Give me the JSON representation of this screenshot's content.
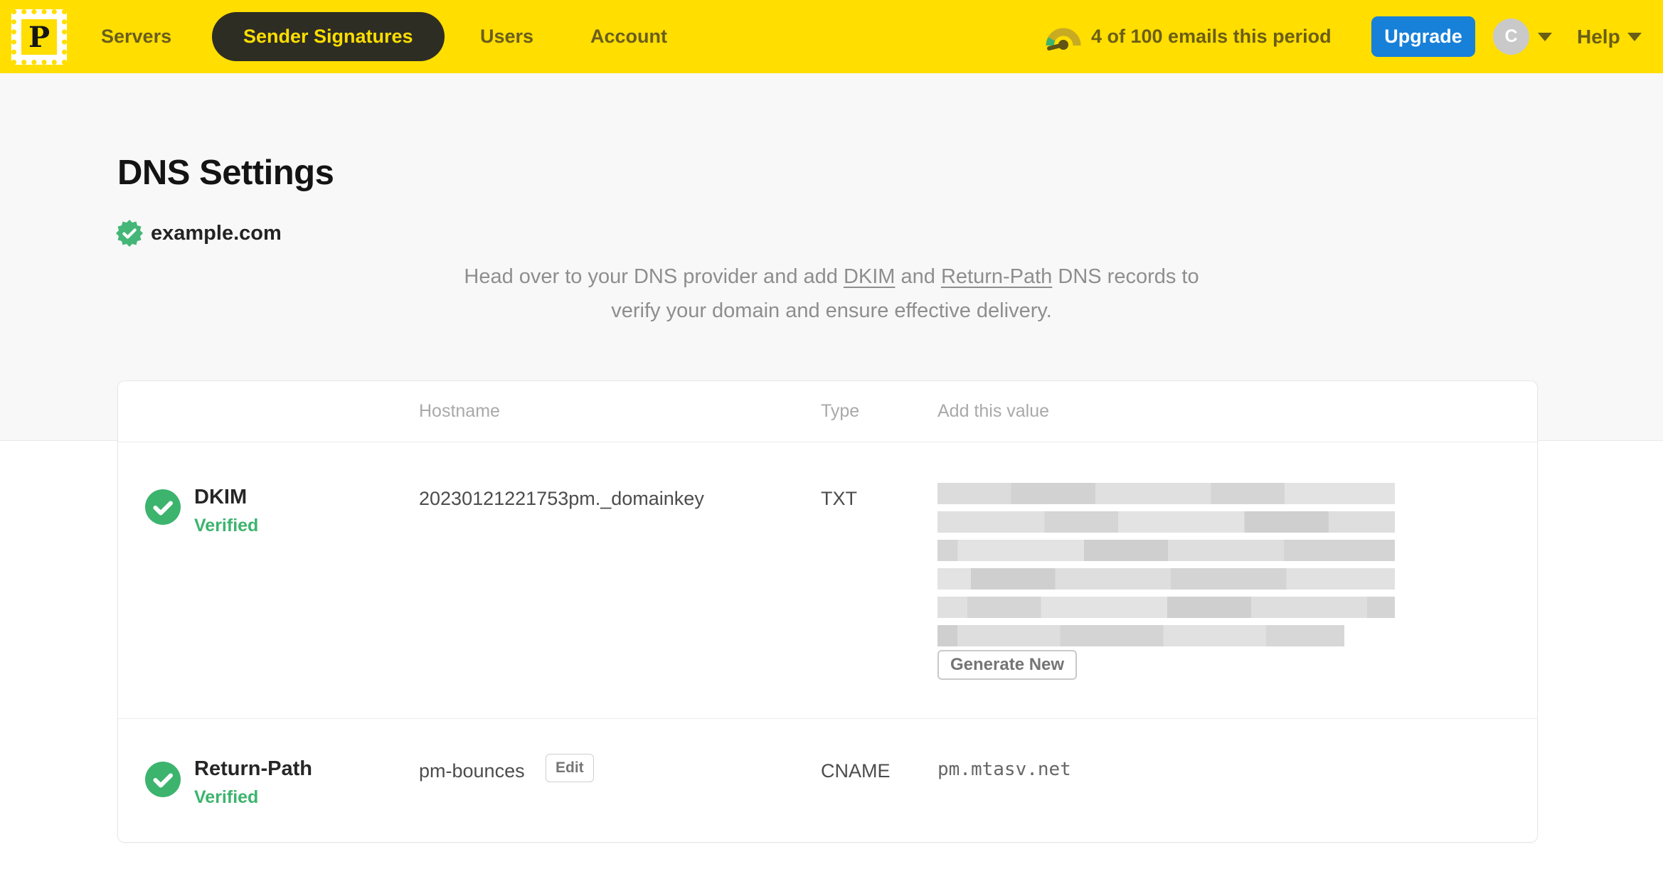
{
  "nav": {
    "logo_letter": "P",
    "items": [
      {
        "label": "Servers",
        "active": false
      },
      {
        "label": "Sender Signatures",
        "active": true
      },
      {
        "label": "Users",
        "active": false
      },
      {
        "label": "Account",
        "active": false
      }
    ],
    "usage_text": "4 of 100 emails this period",
    "upgrade_label": "Upgrade",
    "avatar_initial": "C",
    "help_label": "Help"
  },
  "page": {
    "title": "DNS Settings",
    "domain": "example.com",
    "instructions": {
      "line1_prefix": "Head over to your DNS provider and add ",
      "dkim_link": "DKIM",
      "line1_mid": " and ",
      "return_path_link": "Return-Path",
      "line1_suffix": " DNS records to",
      "line2": "verify your domain and ensure effective delivery."
    }
  },
  "table": {
    "headers": {
      "hostname": "Hostname",
      "type": "Type",
      "value": "Add this value"
    },
    "rows": [
      {
        "name": "DKIM",
        "status": "Verified",
        "hostname": "20230121221753pm._domainkey",
        "type": "TXT",
        "value_redacted": true,
        "action_label": "Generate New"
      },
      {
        "name": "Return-Path",
        "status": "Verified",
        "hostname": "pm-bounces",
        "edit_label": "Edit",
        "type": "CNAME",
        "value": "pm.mtasv.net"
      }
    ]
  },
  "colors": {
    "brand_yellow": "#FFDE00",
    "nav_text": "#6a5e1d",
    "active_pill_bg": "#2d2d24",
    "upgrade_blue": "#1780d9",
    "verified_green": "#3cb46e",
    "muted_text": "#8e8e8e"
  }
}
